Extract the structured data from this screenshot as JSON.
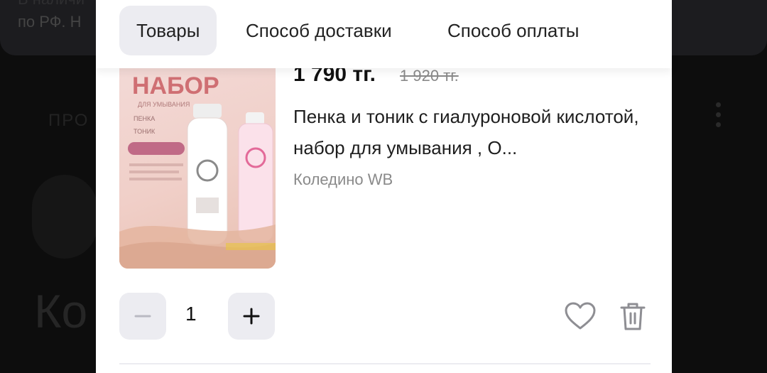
{
  "background": {
    "banner_line1": "В наличи",
    "banner_line2": "по РФ. Н",
    "side_label": "ПРО",
    "heading": "Ко"
  },
  "tabs": [
    {
      "label": "Товары",
      "active": true
    },
    {
      "label": "Способ доставки",
      "active": false
    },
    {
      "label": "Способ оплаты",
      "active": false
    }
  ],
  "product": {
    "image": {
      "headline": "НАБОР",
      "subline": "ДЛЯ УМЫВАНИЯ",
      "items": [
        "ПЕНКА",
        "ТОНИК"
      ]
    },
    "price_current": "1 790 тг.",
    "price_old": "1 920 тг.",
    "title": "Пенка и тоник с гиалуроновой кислотой, набор для умывания , О...",
    "warehouse": "Коледино WB",
    "quantity": "1"
  },
  "icons": {
    "minus": "minus-icon",
    "plus": "plus-icon",
    "favorite": "heart-icon",
    "delete": "trash-icon"
  },
  "colors": {
    "accent_bg": "#ececf1",
    "text": "#222222",
    "muted": "#8a8a8a",
    "image_headline": "#cf6f73"
  }
}
